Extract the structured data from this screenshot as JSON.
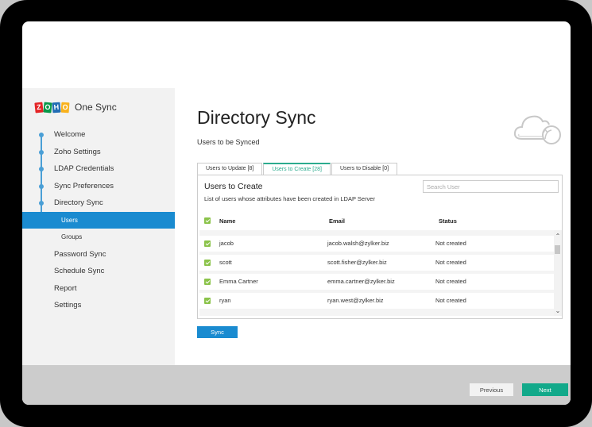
{
  "app": {
    "logo_letters": [
      "Z",
      "O",
      "H",
      "O"
    ],
    "name": "One Sync"
  },
  "sidebar": {
    "items": [
      {
        "label": "Welcome"
      },
      {
        "label": "Zoho Settings"
      },
      {
        "label": "LDAP Credentials"
      },
      {
        "label": "Sync Preferences"
      },
      {
        "label": "Directory Sync"
      },
      {
        "label": "Users",
        "active": true
      },
      {
        "label": "Groups"
      },
      {
        "label": "Password Sync"
      },
      {
        "label": "Schedule Sync"
      },
      {
        "label": "Report"
      },
      {
        "label": "Settings"
      }
    ]
  },
  "main": {
    "title": "Directory Sync",
    "subtitle": "Users to be Synced",
    "cloud_icon": "cloud-sync-icon",
    "tabs": [
      {
        "label": "Users to Update [8]"
      },
      {
        "label": "Users to Create [28]",
        "active": true
      },
      {
        "label": "Users to Disable [0]"
      }
    ],
    "panel": {
      "title": "Users to Create",
      "description": "List of users whose attributes have been created in LDAP Server",
      "search_placeholder": "Search User",
      "columns": {
        "name": "Name",
        "email": "Email",
        "status": "Status"
      },
      "rows": [
        {
          "name": "jacob",
          "email": "jacob.walsh@zylker.biz",
          "status": "Not created",
          "checked": true
        },
        {
          "name": "scott",
          "email": "scott.fisher@zylker.biz",
          "status": "Not created",
          "checked": true
        },
        {
          "name": "Emma Cartner",
          "email": "emma.cartner@zylker.biz",
          "status": "Not created",
          "checked": true
        },
        {
          "name": "ryan",
          "email": "ryan.west@zylker.biz",
          "status": "Not created",
          "checked": true
        }
      ],
      "scroll_up": "⌃",
      "scroll_down": "⌄"
    },
    "sync_label": "Sync"
  },
  "footer": {
    "previous_label": "Previous",
    "next_label": "Next"
  },
  "colors": {
    "accent_blue": "#1a8bd0",
    "accent_green": "#12a98a",
    "checkbox_green": "#8bc34a",
    "tab_active": "#2bab8e"
  }
}
